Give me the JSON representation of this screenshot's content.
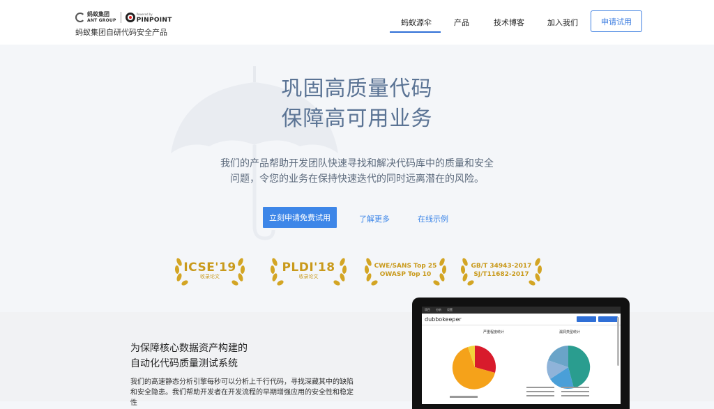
{
  "header": {
    "logo_ant_cn": "蚂蚁集团",
    "logo_ant_en": "ANT GROUP",
    "logo_pin_small": "Powered by",
    "logo_pin_big": "PINPOINT",
    "logo_subtitle": "蚂蚁集团自研代码安全产品",
    "nav": [
      "蚂蚁源伞",
      "产品",
      "技术博客",
      "加入我们"
    ],
    "apply_label": "申请试用"
  },
  "hero": {
    "title_line1": "巩固高质量代码",
    "title_line2": "保障高可用业务",
    "desc_line1": "我们的产品帮助开发团队快速寻找和解决代码库中的质量和安全",
    "desc_line2": "问题，令您的业务在保持快速迭代的同时远离潜在的风险。",
    "cta_primary": "立刻申请免费试用",
    "cta_learn": "了解更多",
    "cta_demo": "在线示例"
  },
  "badges": [
    {
      "main": "ICSE'19",
      "sub": "收录论文"
    },
    {
      "main": "PLDI'18",
      "sub": "收录论文"
    },
    {
      "line1": "CWE/SANS Top 25",
      "line2": "OWASP Top 10"
    },
    {
      "line1": "GB/T 34943-2017",
      "line2": "SJ/T11682-2017"
    }
  ],
  "section": {
    "title_line1": "为保障核心数据资产构建的",
    "title_line2": "自动化代码质量测试系统",
    "desc": "我们的高速静态分析引擎每秒可以分析上千行代码，寻找深藏其中的缺陷和安全隐患。我们帮助开发者在开发流程的早期增强应用的安全性和稳定性"
  },
  "screenshot": {
    "tabs": [
      "项目",
      "分析",
      "设置"
    ],
    "project": "dubbokeeper",
    "pie1_title": "严重程度统计",
    "pie2_title": "漏洞类型统计"
  },
  "colors": {
    "accent": "#3d86e8",
    "hero_title": "#5a7394",
    "badge_gold": "#c99a1c"
  }
}
